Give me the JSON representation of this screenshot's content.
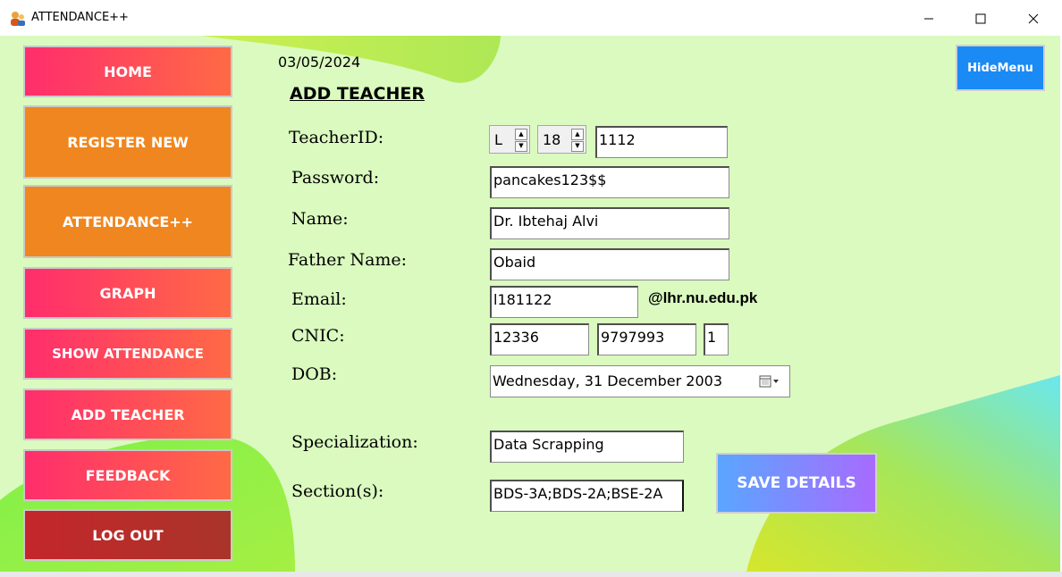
{
  "window": {
    "title": "ATTENDANCE++",
    "minimize_icon": "minimize-icon",
    "maximize_icon": "maximize-icon",
    "close_icon": "close-icon"
  },
  "nav": [
    {
      "label": "HOME",
      "style": "pink"
    },
    {
      "label": "REGISTER NEW",
      "style": "orange"
    },
    {
      "label": "ATTENDANCE++",
      "style": "orange"
    },
    {
      "label": "GRAPH",
      "style": "pink"
    },
    {
      "label": "SHOW ATTENDANCE",
      "style": "pink"
    },
    {
      "label": "ADD TEACHER",
      "style": "pink"
    },
    {
      "label": "FEEDBACK",
      "style": "pink"
    },
    {
      "label": "LOG OUT",
      "style": "red"
    }
  ],
  "header": {
    "date": "03/05/2024",
    "heading": "ADD TEACHER",
    "hide_menu_label": "HideMenu"
  },
  "form": {
    "teacher_id_label": "TeacherID:",
    "id_prefix_value": "L",
    "id_year_value": "18",
    "id_number_value": "1112",
    "password_label": "Password:",
    "password_value": "pancakes123$$",
    "name_label": "Name:",
    "name_value": "Dr. Ibtehaj Alvi",
    "father_label": "Father Name:",
    "father_value": "Obaid",
    "email_label": "Email:",
    "email_value": "l181122",
    "email_domain": "@lhr.nu.edu.pk",
    "cnic_label": "CNIC:",
    "cnic_part1": "12336",
    "cnic_part2": "9797993",
    "cnic_part3": "1",
    "dob_label": "DOB:",
    "dob_value": "Wednesday, 31 December 2003",
    "specialization_label": "Specialization:",
    "specialization_value": "Data Scrapping",
    "sections_label": "Section(s):",
    "sections_value": "BDS-3A;BDS-2A;BSE-2A",
    "save_label": "SAVE DETAILS"
  },
  "colors": {
    "background": "#dafabf",
    "nav_pink": "#ff2d6c",
    "nav_orange": "#f0861f",
    "logout_red": "#c4262b",
    "hide_menu_blue": "#1a8af5",
    "save_gradient_start": "#5aa6ff",
    "save_gradient_end": "#a86bff"
  }
}
